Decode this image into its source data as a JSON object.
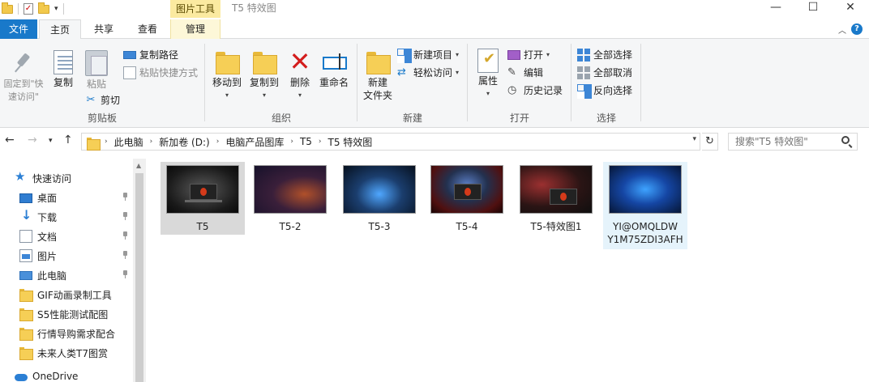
{
  "window": {
    "title": "T5 特效图",
    "context_tab": "图片工具",
    "controls": {
      "minimize": "—",
      "maximize": "☐",
      "close": "✕"
    }
  },
  "tabs": {
    "file": "文件",
    "home": "主页",
    "share": "共享",
    "view": "查看",
    "manage": "管理",
    "help": "?"
  },
  "ribbon": {
    "clipboard": {
      "label": "剪贴板",
      "pin": "固定到\"快速访问\"",
      "copy": "复制",
      "paste": "粘贴",
      "copy_path": "复制路径",
      "paste_shortcut": "粘贴快捷方式",
      "cut": "剪切"
    },
    "organize": {
      "label": "组织",
      "move_to": "移动到",
      "copy_to": "复制到",
      "delete": "删除",
      "rename": "重命名"
    },
    "new": {
      "label": "新建",
      "new_folder": "新建\n文件夹",
      "new_item": "新建项目",
      "easy_access": "轻松访问"
    },
    "open": {
      "label": "打开",
      "properties": "属性",
      "open": "打开",
      "edit": "编辑",
      "history": "历史记录"
    },
    "select": {
      "label": "选择",
      "select_all": "全部选择",
      "select_none": "全部取消",
      "invert": "反向选择"
    }
  },
  "address": {
    "crumbs": [
      "此电脑",
      "新加卷 (D:)",
      "电脑产品图库",
      "T5",
      "T5 特效图"
    ],
    "search_placeholder": "搜索\"T5 特效图\""
  },
  "nav": {
    "items": [
      {
        "label": "快速访问",
        "icon": "star-icon",
        "pinned": false
      },
      {
        "label": "桌面",
        "icon": "desktop-icon",
        "pinned": true
      },
      {
        "label": "下载",
        "icon": "download-icon",
        "pinned": true
      },
      {
        "label": "文档",
        "icon": "document-icon",
        "pinned": true
      },
      {
        "label": "图片",
        "icon": "picture-icon",
        "pinned": true
      },
      {
        "label": "此电脑",
        "icon": "computer-icon",
        "pinned": true
      },
      {
        "label": "GIF动画录制工具",
        "icon": "folder-icon",
        "pinned": false
      },
      {
        "label": "S5性能测试配图",
        "icon": "folder-icon",
        "pinned": false
      },
      {
        "label": "行情导购需求配合",
        "icon": "folder-icon",
        "pinned": false
      },
      {
        "label": "未来人类T7图赏",
        "icon": "folder-icon",
        "pinned": false
      },
      {
        "label": "OneDrive",
        "icon": "cloud-icon",
        "pinned": false
      }
    ]
  },
  "files": [
    {
      "name": "T5",
      "state": "selected"
    },
    {
      "name": "T5-2",
      "state": "normal"
    },
    {
      "name": "T5-3",
      "state": "normal"
    },
    {
      "name": "T5-4",
      "state": "normal"
    },
    {
      "name": "T5-特效图1",
      "state": "normal"
    },
    {
      "name": "YI@OMQLDW\nY1M75ZDI3AFH",
      "state": "hover"
    }
  ],
  "colors": {
    "accent": "#1979ca",
    "context_tab": "#fbeaa0",
    "selected": "#d9d9d9",
    "hover": "#e5f3fb"
  }
}
